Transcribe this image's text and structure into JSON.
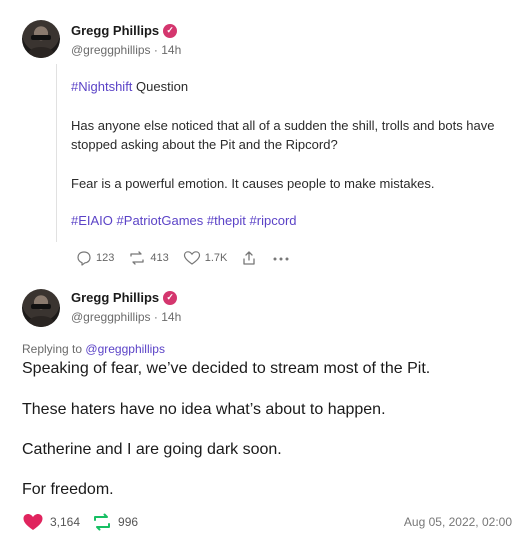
{
  "posts": [
    {
      "author": {
        "name": "Gregg Phillips",
        "handle": "@greggphillips",
        "time": "14h"
      },
      "body": {
        "line1_tag": "#Nightshift",
        "line1_text": " Question",
        "para2": "Has anyone else noticed that all of a sudden the shill, trolls and bots have stopped asking about the Pit and the Ripcord?",
        "para3": "Fear is a powerful emotion. It causes people to make mistakes.",
        "tags": [
          "#EIAIO",
          "#PatriotGames",
          "#thepit",
          "#ripcord"
        ]
      },
      "actions": {
        "replies": "123",
        "reposts": "413",
        "likes": "1.7K"
      }
    },
    {
      "author": {
        "name": "Gregg Phillips",
        "handle": "@greggphillips",
        "time": "14h"
      },
      "replying_to_label": "Replying to",
      "replying_to_handle": "@greggphillips",
      "body": [
        "Speaking of fear, we’ve decided to stream most of the Pit.",
        "These haters have no idea what’s about to happen.",
        "Catherine and I are going dark soon.",
        "For freedom."
      ],
      "stats": {
        "likes": "3,164",
        "reposts": "996",
        "date": "Aug 05, 2022, 02:00"
      }
    }
  ],
  "colors": {
    "accent": "#5b43c7",
    "verified": "#d4366e",
    "like": "#e0245e",
    "repost": "#17bf63"
  },
  "icons": [
    "verified-badge-icon",
    "reply-icon",
    "repost-icon",
    "like-icon",
    "share-icon",
    "more-icon"
  ]
}
